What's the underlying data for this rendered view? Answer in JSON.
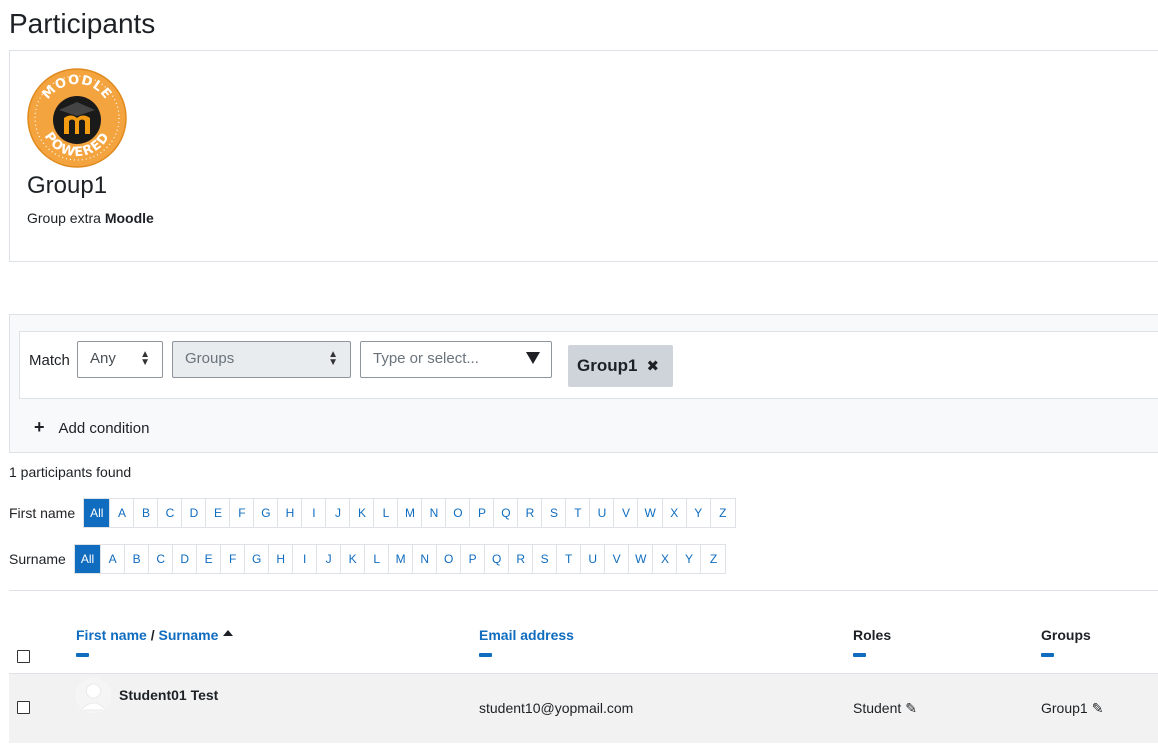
{
  "page": {
    "title": "Participants"
  },
  "group": {
    "name": "Group1",
    "description_prefix": "Group extra ",
    "description_bold": "Moodle",
    "logo_top_text": "MOODLE",
    "logo_bottom_text": "POWERED"
  },
  "filter": {
    "match_label": "Match",
    "match_value": "Any",
    "type_value": "Groups",
    "value_placeholder": "Type or select...",
    "selected_chip": "Group1",
    "add_condition_label": "Add condition"
  },
  "results": {
    "count_text": "1 participants found"
  },
  "initials": {
    "first_name_label": "First name",
    "surname_label": "Surname",
    "letters": [
      "All",
      "A",
      "B",
      "C",
      "D",
      "E",
      "F",
      "G",
      "H",
      "I",
      "J",
      "K",
      "L",
      "M",
      "N",
      "O",
      "P",
      "Q",
      "R",
      "S",
      "T",
      "U",
      "V",
      "W",
      "X",
      "Y",
      "Z"
    ]
  },
  "table": {
    "headers": {
      "first_name": "First name",
      "slash": " / ",
      "surname": "Surname",
      "email": "Email address",
      "roles": "Roles",
      "groups": "Groups"
    },
    "rows": [
      {
        "name": "Student01 Test",
        "email": "student10@yopmail.com",
        "role": "Student",
        "group": "Group1"
      }
    ]
  },
  "colors": {
    "link": "#0f6cbf",
    "chip_bg": "#ced4da",
    "panel_bg": "#f8f9fa",
    "row_bg": "#f2f2f2",
    "logo_orange": "#f3a43f"
  }
}
